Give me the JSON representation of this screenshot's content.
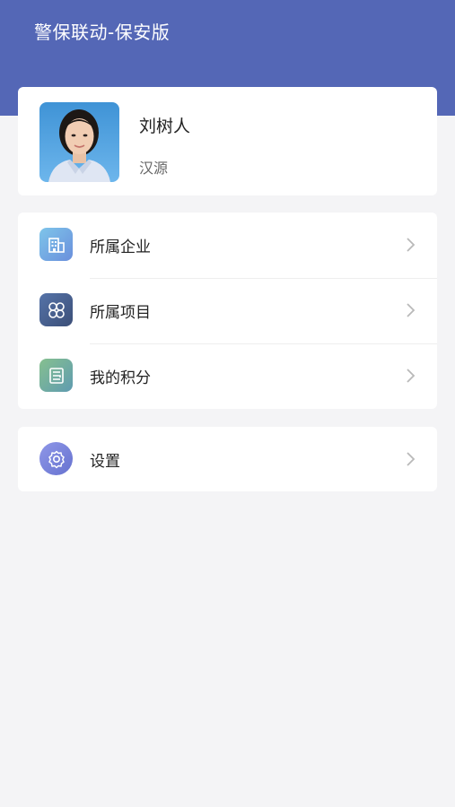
{
  "app": {
    "title": "警保联动-保安版",
    "accent_color": "#5467b6"
  },
  "profile": {
    "name": "刘树人",
    "organization": "汉源",
    "avatar_icon": "user-photo"
  },
  "menu": {
    "items": [
      {
        "label": "所属企业",
        "icon": "building-icon",
        "color": "#6aa6e3"
      },
      {
        "label": "所属项目",
        "icon": "project-grid-icon",
        "color": "#4a5d8f"
      },
      {
        "label": "我的积分",
        "icon": "points-ledger-icon",
        "color": "#6cae8a"
      }
    ]
  },
  "settings": {
    "label": "设置",
    "icon": "gear-icon",
    "color": "#7681d8"
  }
}
